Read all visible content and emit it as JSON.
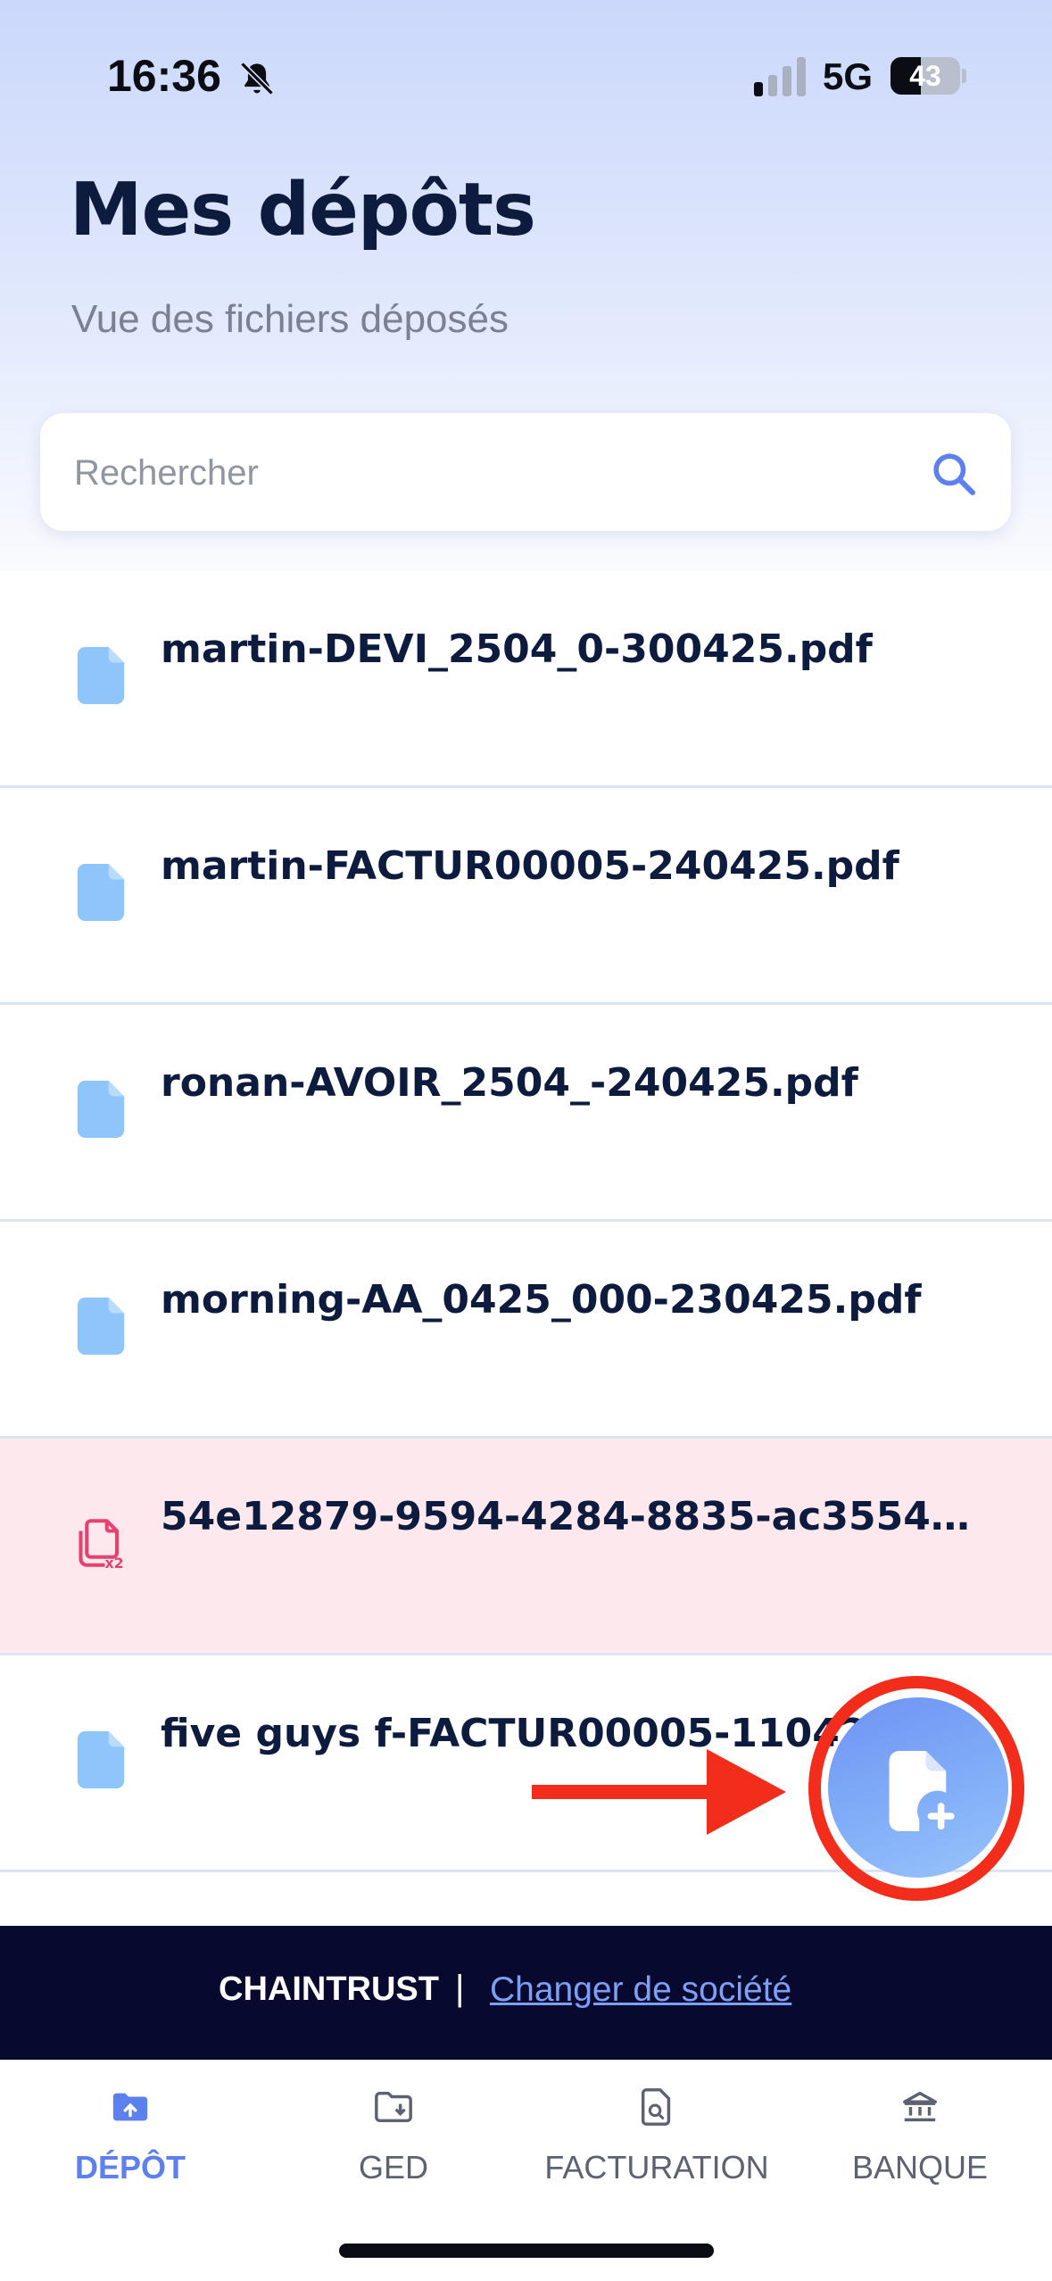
{
  "status_bar": {
    "time": "16:36",
    "network": "5G",
    "battery": "43",
    "battery_level": 0.43
  },
  "header": {
    "title": "Mes dépôts",
    "subtitle": "Vue des fichiers déposés"
  },
  "search": {
    "placeholder": "Rechercher",
    "value": ""
  },
  "files": [
    {
      "name": "martin-DEVI_2504_0-300425.pdf",
      "status": "ok"
    },
    {
      "name": "martin-FACTUR00005-240425.pdf",
      "status": "ok"
    },
    {
      "name": "ronan-AVOIR_2504_-240425.pdf",
      "status": "ok"
    },
    {
      "name": "morning-AA_0425_000-230425.pdf",
      "status": "ok"
    },
    {
      "name": "54e12879-9594-4284-8835-ac3554e…",
      "status": "duplicate"
    },
    {
      "name": "five guys f-FACTUR00005-11042",
      "status": "ok"
    }
  ],
  "company_bar": {
    "company_name": "CHAINTRUST",
    "separator": "|",
    "change_link": "Changer de société"
  },
  "bottom_nav": {
    "items": [
      {
        "label": "DÉPÔT",
        "icon": "folder-upload-icon",
        "active": true
      },
      {
        "label": "GED",
        "icon": "folder-download-icon",
        "active": false
      },
      {
        "label": "FACTURATION",
        "icon": "invoice-search-icon",
        "active": false
      },
      {
        "label": "BANQUE",
        "icon": "bank-icon",
        "active": false
      }
    ]
  },
  "colors": {
    "accent": "#5c80ee",
    "title": "#0d1b3e",
    "error_row": "#fde8ee",
    "company_bar": "#070a2e",
    "annotation": "#f22d1b"
  }
}
